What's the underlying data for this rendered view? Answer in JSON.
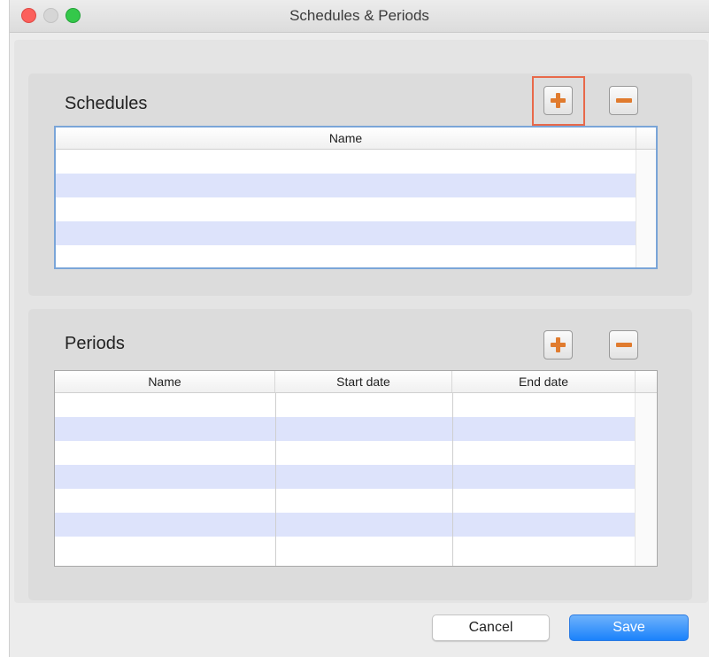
{
  "window": {
    "title": "Schedules & Periods"
  },
  "schedules": {
    "title": "Schedules",
    "columns": [
      "Name"
    ],
    "rows": [
      {
        "name": ""
      },
      {
        "name": ""
      },
      {
        "name": ""
      },
      {
        "name": ""
      },
      {
        "name": ""
      }
    ]
  },
  "periods": {
    "title": "Periods",
    "columns": [
      "Name",
      "Start date",
      "End date"
    ],
    "rows": [
      {
        "name": "",
        "start": "",
        "end": ""
      },
      {
        "name": "",
        "start": "",
        "end": ""
      },
      {
        "name": "",
        "start": "",
        "end": ""
      },
      {
        "name": "",
        "start": "",
        "end": ""
      },
      {
        "name": "",
        "start": "",
        "end": ""
      },
      {
        "name": "",
        "start": "",
        "end": ""
      },
      {
        "name": "",
        "start": "",
        "end": ""
      }
    ]
  },
  "icons": {
    "add": "plus-icon",
    "remove": "minus-icon",
    "accent": "#e07b2e",
    "highlight": "#e8694a"
  },
  "buttons": {
    "cancel": "Cancel",
    "save": "Save"
  }
}
